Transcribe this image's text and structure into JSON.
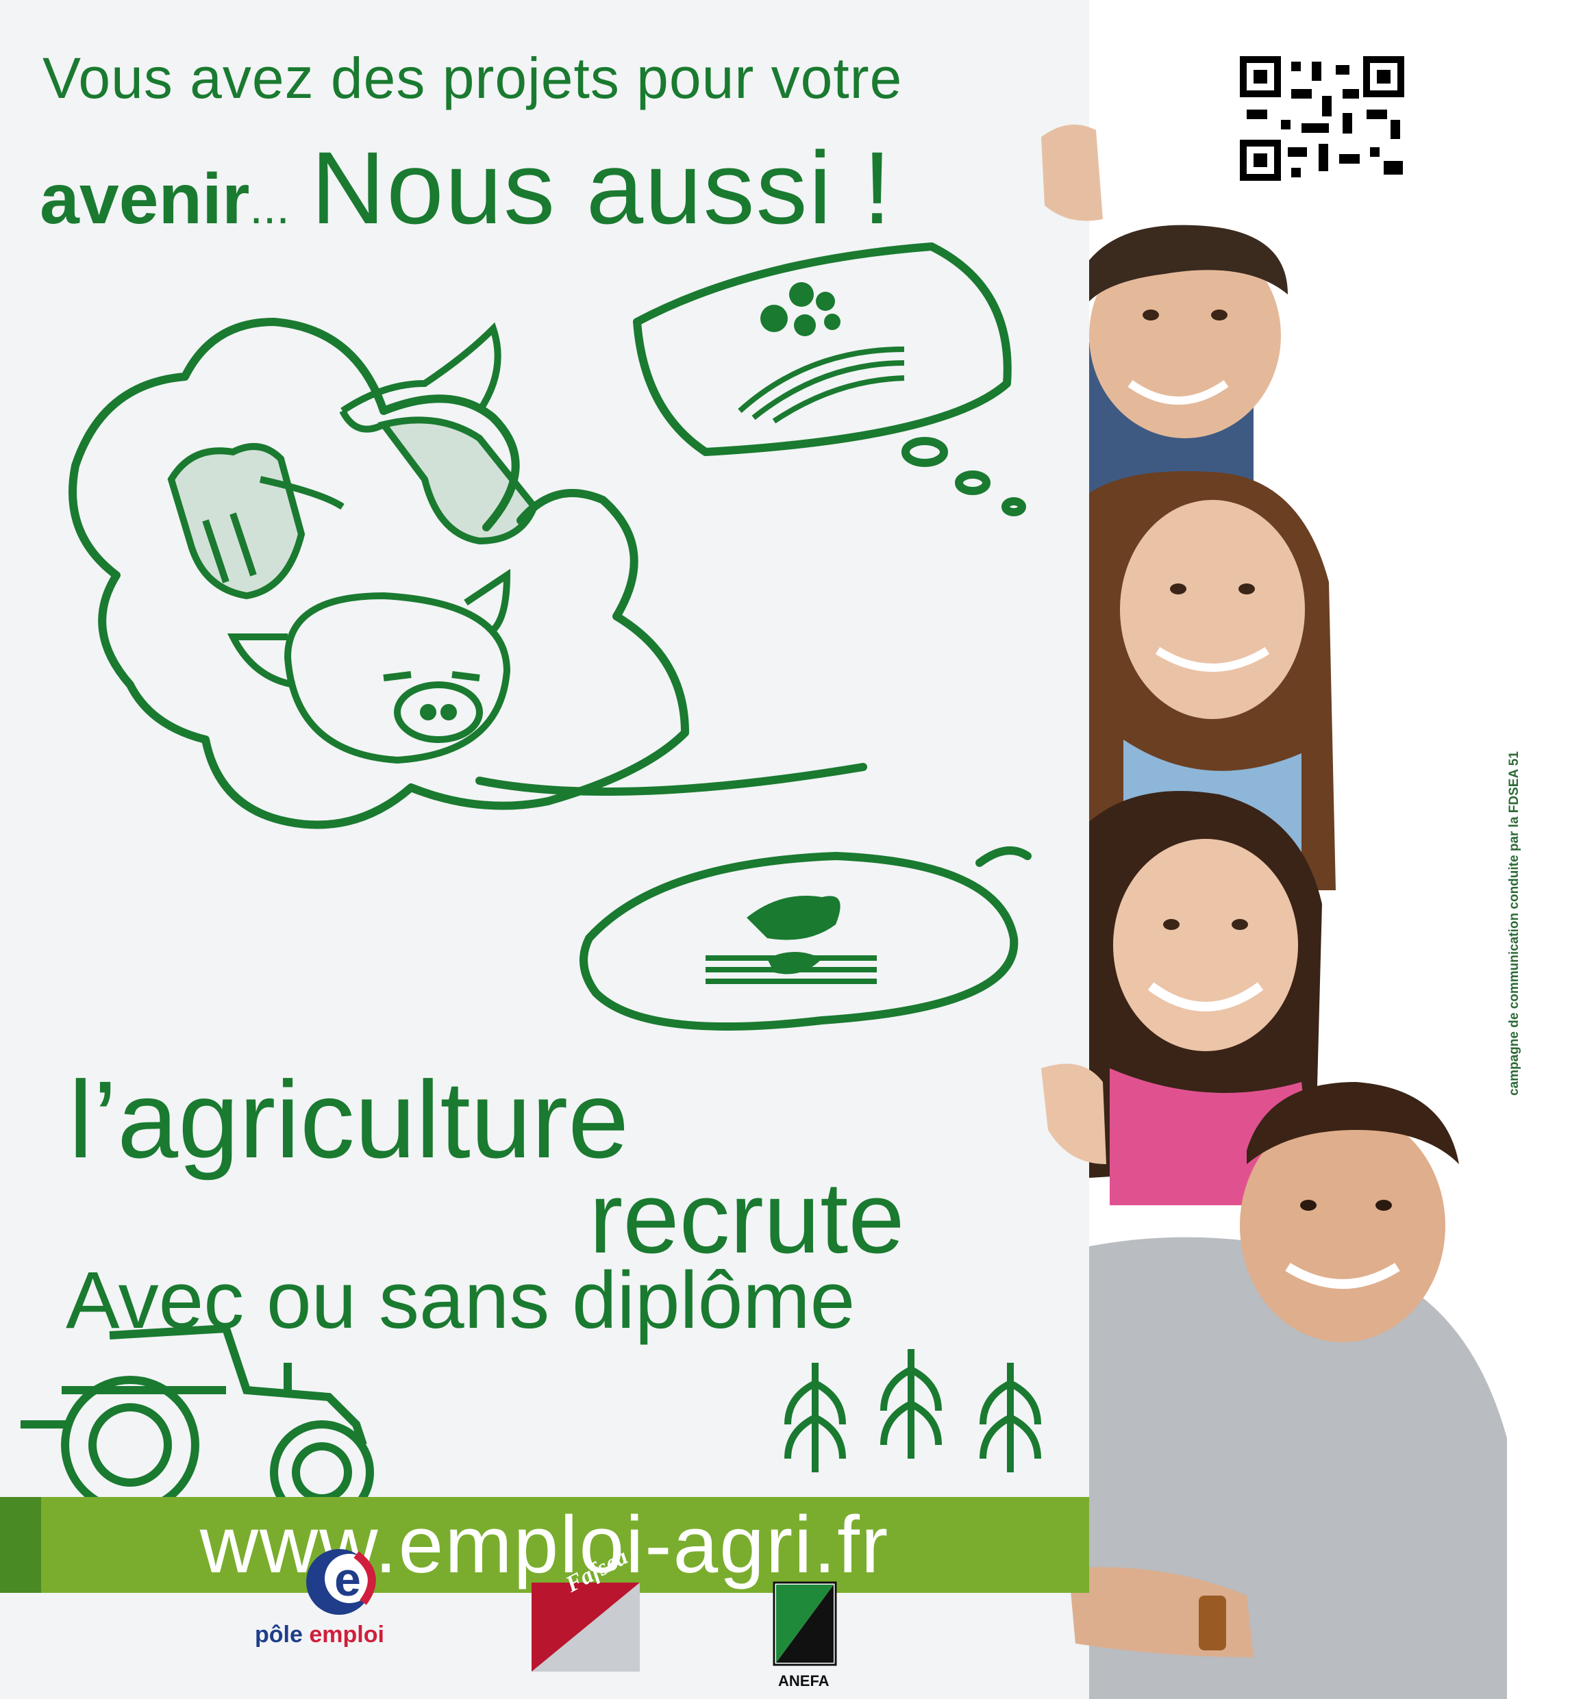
{
  "headline": {
    "line1": "Vous avez des projets pour votre",
    "line2_bold": "avenir",
    "line2_dots": "...",
    "line2_thin": "Nous aussi !"
  },
  "tagline": {
    "line1": "l’agriculture",
    "line2": "recrute",
    "line3": "Avec ou sans diplôme"
  },
  "website": "www.emploi-agri.fr",
  "logos": {
    "pole_emploi_a": "pôle",
    "pole_emploi_b": "emploi",
    "fafsea": "Fafsea",
    "anefa": "ANEFA"
  },
  "side_caption": "campagne de communication conduite par la FDSEA 51",
  "icons": [
    "qr-code-icon",
    "sheep-icon",
    "cow-icon",
    "pig-icon",
    "fields-icon",
    "handshake-icon",
    "tractor-icon",
    "wheat-icon"
  ],
  "colors": {
    "brand_green": "#1a7a30",
    "band_green": "#7aad2e",
    "poster_background": "#f2f4f5",
    "pole_emploi_blue": "#1f3d8a",
    "pole_emploi_red": "#d01f3c"
  }
}
